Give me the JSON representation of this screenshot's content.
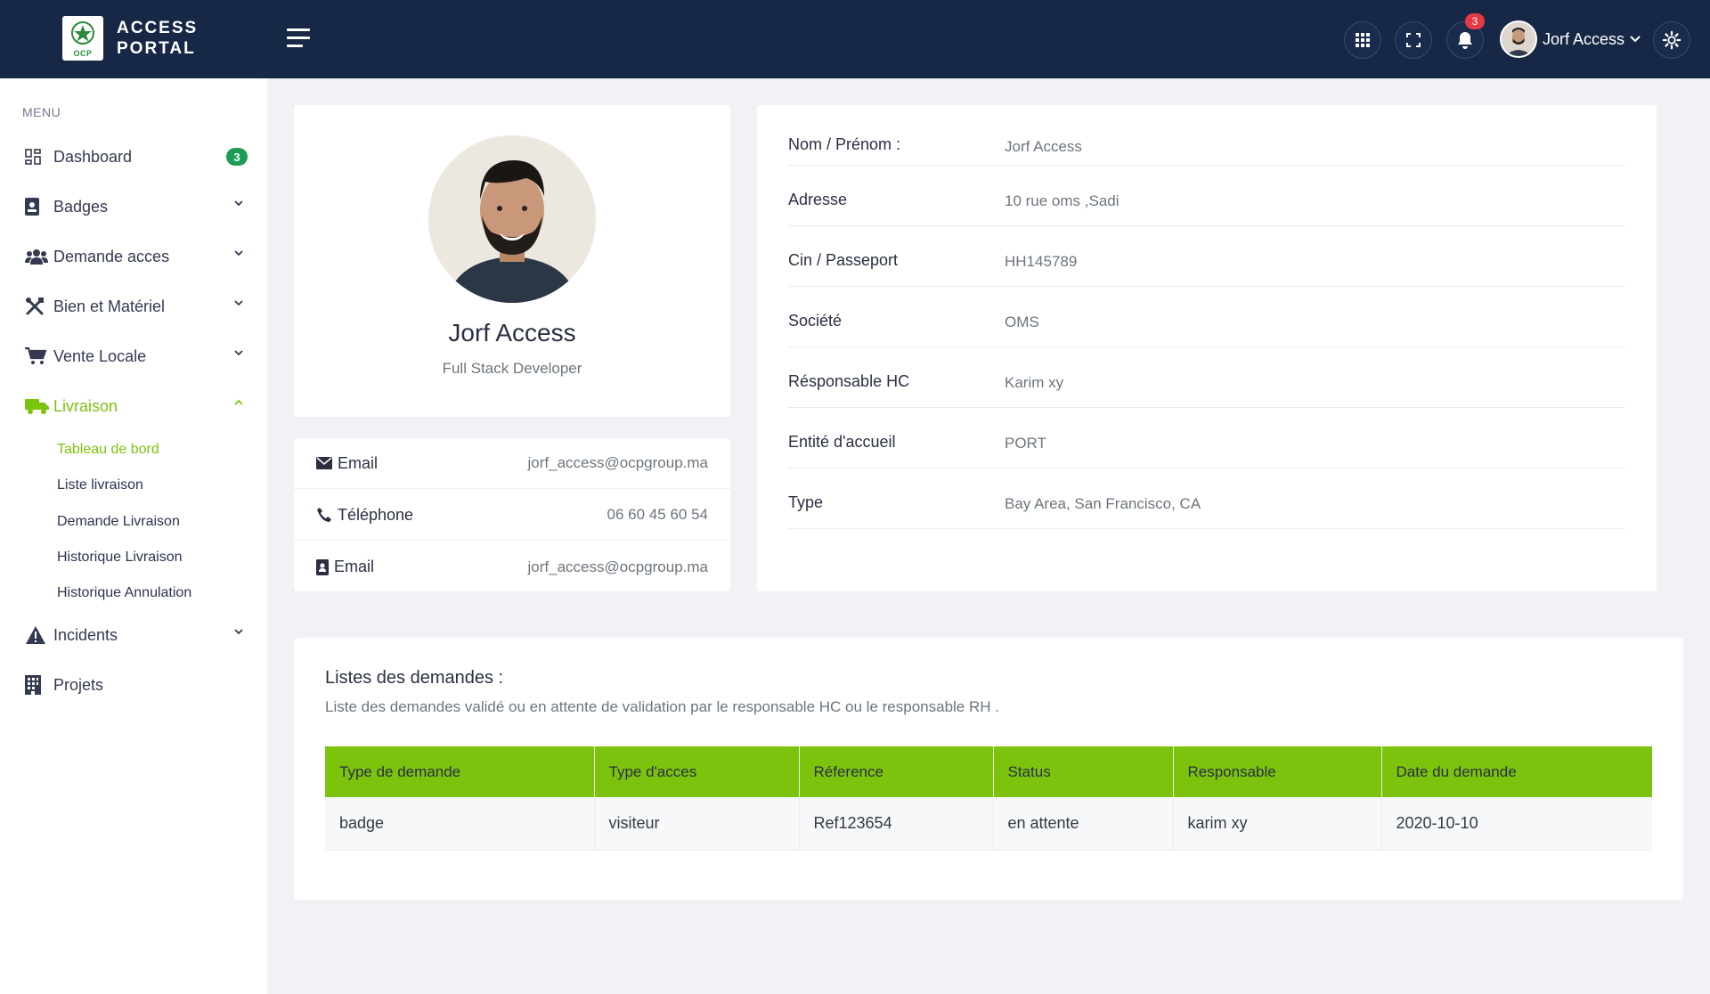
{
  "brand": {
    "line1": "ACCESS",
    "line2": "PORTAL",
    "logo_text": "OCP"
  },
  "header": {
    "notification_count": "3",
    "user_name": "Jorf Access",
    "icons": [
      "grid-icon",
      "fullscreen-icon",
      "bell-icon",
      "chevron-down-icon",
      "gear-icon"
    ]
  },
  "sidebar": {
    "menu_title": "MENU",
    "items": [
      {
        "label": "Dashboard",
        "badge": "3",
        "icon": "dashboard-icon"
      },
      {
        "label": "Badges",
        "icon": "badge-icon"
      },
      {
        "label": "Demande acces",
        "icon": "users-icon"
      },
      {
        "label": "Bien et Matériel",
        "icon": "tools-icon"
      },
      {
        "label": "Vente Locale",
        "icon": "cart-icon"
      },
      {
        "label": "Livraison",
        "icon": "truck-icon",
        "active": true
      },
      {
        "label": "Incidents",
        "icon": "warning-icon"
      },
      {
        "label": "Projets",
        "icon": "building-icon"
      }
    ],
    "livraison_sub": [
      {
        "label": "Tableau de bord",
        "active": true
      },
      {
        "label": "Liste livraison"
      },
      {
        "label": "Demande Livraison"
      },
      {
        "label": "Historique Livraison"
      },
      {
        "label": "Historique Annulation"
      }
    ]
  },
  "profile": {
    "name": "Jorf Access",
    "role": "Full Stack Developer",
    "contacts": [
      {
        "label": "Email",
        "value": "jorf_access@ocpgroup.ma",
        "icon": "envelope-icon"
      },
      {
        "label": "Téléphone",
        "value": "06 60 45 60 54",
        "icon": "phone-icon"
      },
      {
        "label": "Email",
        "value": "jorf_access@ocpgroup.ma",
        "icon": "contact-card-icon"
      }
    ]
  },
  "details": [
    {
      "label": "Nom / Prénom :",
      "value": "Jorf Access"
    },
    {
      "label": "Adresse",
      "value": "10 rue oms ,Sadi"
    },
    {
      "label": "Cin / Passeport",
      "value": "HH145789"
    },
    {
      "label": "Société",
      "value": "OMS"
    },
    {
      "label": "Résponsable HC",
      "value": "Karim xy"
    },
    {
      "label": "Entité d'accueil",
      "value": "PORT"
    },
    {
      "label": "Type",
      "value": "Bay Area, San Francisco, CA"
    }
  ],
  "requests": {
    "title": "Listes des demandes :",
    "description": "Liste des demandes validé ou en attente de validation par le responsable HC ou le responsable RH .",
    "columns": [
      "Type de demande",
      "Type d'acces",
      "Réference",
      "Status",
      "Responsable",
      "Date du demande"
    ],
    "rows": [
      [
        "badge",
        "visiteur",
        "Ref123654",
        "en attente",
        "karim xy",
        "2020-10-10"
      ]
    ]
  },
  "colors": {
    "topbar": "#172846",
    "accent": "#7cc30e",
    "badge_green": "#1e9c56",
    "notification": "#e63946"
  }
}
